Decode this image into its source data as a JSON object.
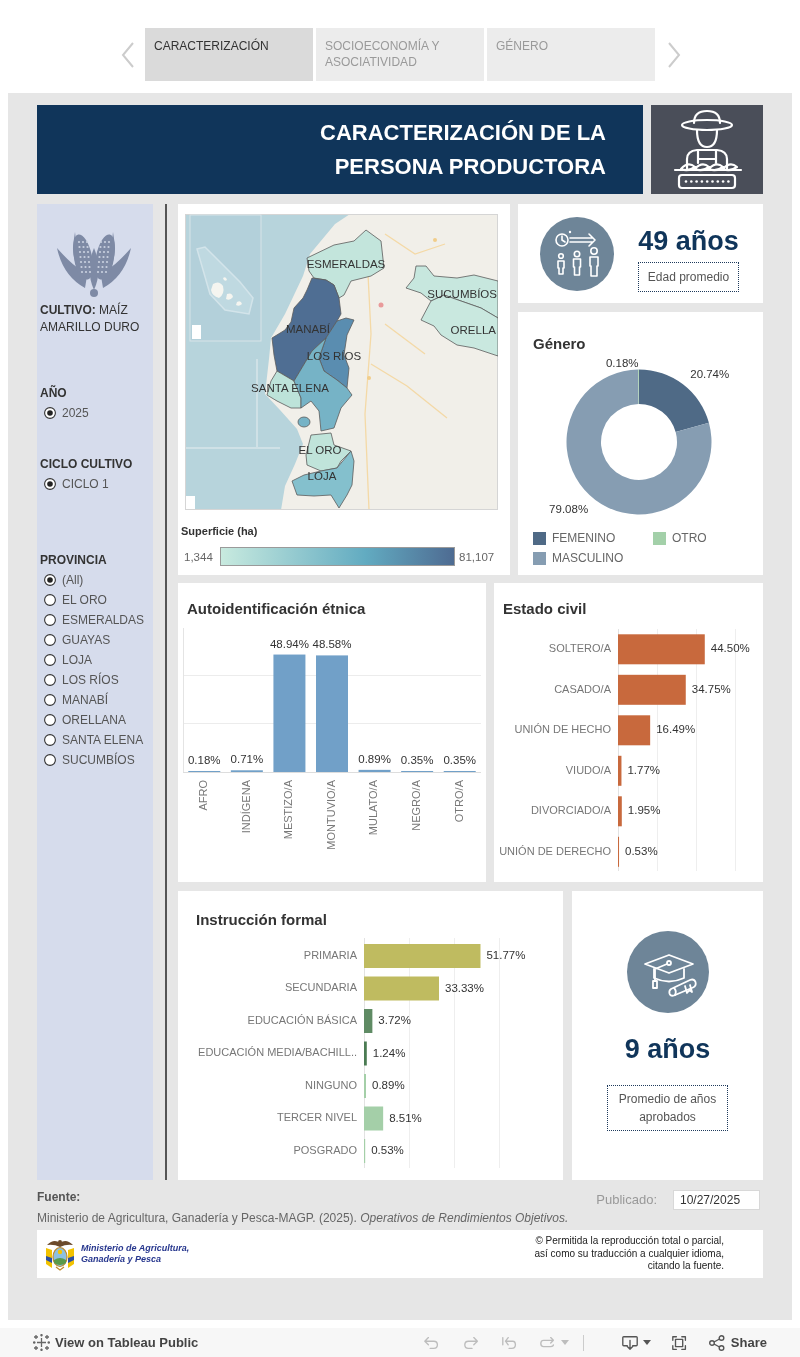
{
  "tabs": [
    {
      "label": "CARACTERIZACIÓN",
      "selected": true
    },
    {
      "label": "SOCIOECONOMÍA Y ASOCIATIVIDAD",
      "selected": false
    },
    {
      "label": "GÉNERO",
      "selected": false
    }
  ],
  "header": {
    "title": "CARACTERIZACIÓN DE LA PERSONA PRODUCTORA"
  },
  "sidebar": {
    "crop": "**CULTIVO:** MAÍZ AMARILLO DURO",
    "filters": [
      {
        "title": "AÑO",
        "options": [
          {
            "label": "2025",
            "selected": true
          }
        ]
      },
      {
        "title": "CICLO CULTIVO",
        "options": [
          {
            "label": "CICLO 1",
            "selected": true
          }
        ]
      },
      {
        "title": "PROVINCIA",
        "options": [
          {
            "label": "(All)",
            "selected": true
          },
          {
            "label": "EL ORO",
            "selected": false
          },
          {
            "label": "ESMERALDAS",
            "selected": false
          },
          {
            "label": "GUAYAS",
            "selected": false
          },
          {
            "label": "LOJA",
            "selected": false
          },
          {
            "label": "LOS RÍOS",
            "selected": false
          },
          {
            "label": "MANABÍ",
            "selected": false
          },
          {
            "label": "ORELLANA",
            "selected": false
          },
          {
            "label": "SANTA ELENA",
            "selected": false
          },
          {
            "label": "SUCUMBÍOS",
            "selected": false
          }
        ]
      }
    ]
  },
  "map": {
    "regions": [
      {
        "name": "ESMERALDAS",
        "color": "#c3e5dc"
      },
      {
        "name": "SUCUMBÍOS",
        "color": "#c7e7de"
      },
      {
        "name": "ORELLA",
        "color": "#c9e8df"
      },
      {
        "name": "MANABÍ",
        "color": "#4f6e93"
      },
      {
        "name": "LOS RÍOS",
        "color": "#5a8db0"
      },
      {
        "name": "SANTA ELENA",
        "color": "#bde3d9"
      },
      {
        "color": "#76b3c6"
      },
      {
        "name": "EL ORO",
        "color": "#c0e4da"
      },
      {
        "name": "LOJA",
        "color": "#84c0cd"
      }
    ],
    "legend": {
      "title": "Superficie (ha)",
      "min": "1,344",
      "max": "81,107"
    }
  },
  "age": {
    "value": "49 años",
    "label": "Edad promedio"
  },
  "gender": {
    "chart_data": {
      "type": "donut",
      "title": "Género",
      "categories": [
        "FEMENINO",
        "MASCULINO",
        "OTRO"
      ],
      "values": [
        20.74,
        79.08,
        0.18
      ],
      "colors": [
        "#4f6a86",
        "#869db2",
        "#a3d0a9"
      ],
      "value_labels": [
        "20.74%",
        "79.08%",
        "0.18%"
      ]
    }
  },
  "ethnicity": {
    "chart_data": {
      "type": "bar",
      "title": "Autoidentificación étnica",
      "categories": [
        "AFRO",
        "INDÍGENA",
        "MESTIZO/A",
        "MONTUVIO/A",
        "MULATO/A",
        "NEGRO/A",
        "OTRO/A"
      ],
      "values": [
        0.18,
        0.71,
        48.94,
        48.58,
        0.89,
        0.35,
        0.35
      ],
      "value_labels": [
        "0.18%",
        "0.71%",
        "48.94%",
        "48.58%",
        "0.89%",
        "0.35%",
        "0.35%"
      ]
    }
  },
  "civil_status": {
    "chart_data": {
      "type": "bar",
      "orientation": "horizontal",
      "title": "Estado civil",
      "categories": [
        "SOLTERO/A",
        "CASADO/A",
        "UNIÓN DE HECHO",
        "VIUDO/A",
        "DIVORCIADO/A",
        "UNIÓN DE DERECHO"
      ],
      "values": [
        44.5,
        34.75,
        16.49,
        1.77,
        1.95,
        0.53
      ],
      "value_labels": [
        "44.50%",
        "34.75%",
        "16.49%",
        "1.77%",
        "1.95%",
        "0.53%"
      ]
    }
  },
  "education": {
    "chart_data": {
      "type": "bar",
      "orientation": "horizontal",
      "title": "Instrucción formal",
      "categories": [
        "PRIMARIA",
        "SECUNDARIA",
        "EDUCACIÓN BÁSICA",
        "EDUCACIÓN MEDIA/BACHILL..",
        "NINGUNO",
        "TERCER NIVEL",
        "POSGRADO"
      ],
      "values": [
        51.77,
        33.33,
        3.72,
        1.24,
        0.89,
        8.51,
        0.53
      ],
      "colors": [
        "#bfbb60",
        "#bfbb60",
        "#5f8b64",
        "#4b7b53",
        "#a4cfa8",
        "#a4cfa8",
        "#a4cfa8"
      ],
      "value_labels": [
        "51.77%",
        "33.33%",
        "3.72%",
        "1.24%",
        "0.89%",
        "8.51%",
        "0.53%"
      ]
    }
  },
  "schooling": {
    "value": "9 años",
    "label": "Promedio de años aprobados"
  },
  "footer": {
    "source_label": "Fuente:",
    "source": "Ministerio de Agricultura, Ganadería y Pesca-MAGP. (2025). *Operativos de Rendimientos Objetivos.*",
    "published_label": "Publicado:",
    "published_date": "10/27/2025",
    "ministry": "Ministerio de Agricultura,\nGanadería y Pesca",
    "notice": "© Permitida la reproducción total o parcial,\nasí como su traducción a cualquier idioma,\ncitando la fuente."
  },
  "toolbar": {
    "link": "View on Tableau Public",
    "buttons": [
      {
        "kind": "undo",
        "disabled": true
      },
      {
        "kind": "redo",
        "disabled": true
      },
      {
        "kind": "revert",
        "disabled": true
      },
      {
        "kind": "refresh",
        "disabled": true
      },
      {
        "kind": "download",
        "disabled": false
      },
      {
        "kind": "fullscreen",
        "disabled": false
      }
    ],
    "share": "Share"
  }
}
